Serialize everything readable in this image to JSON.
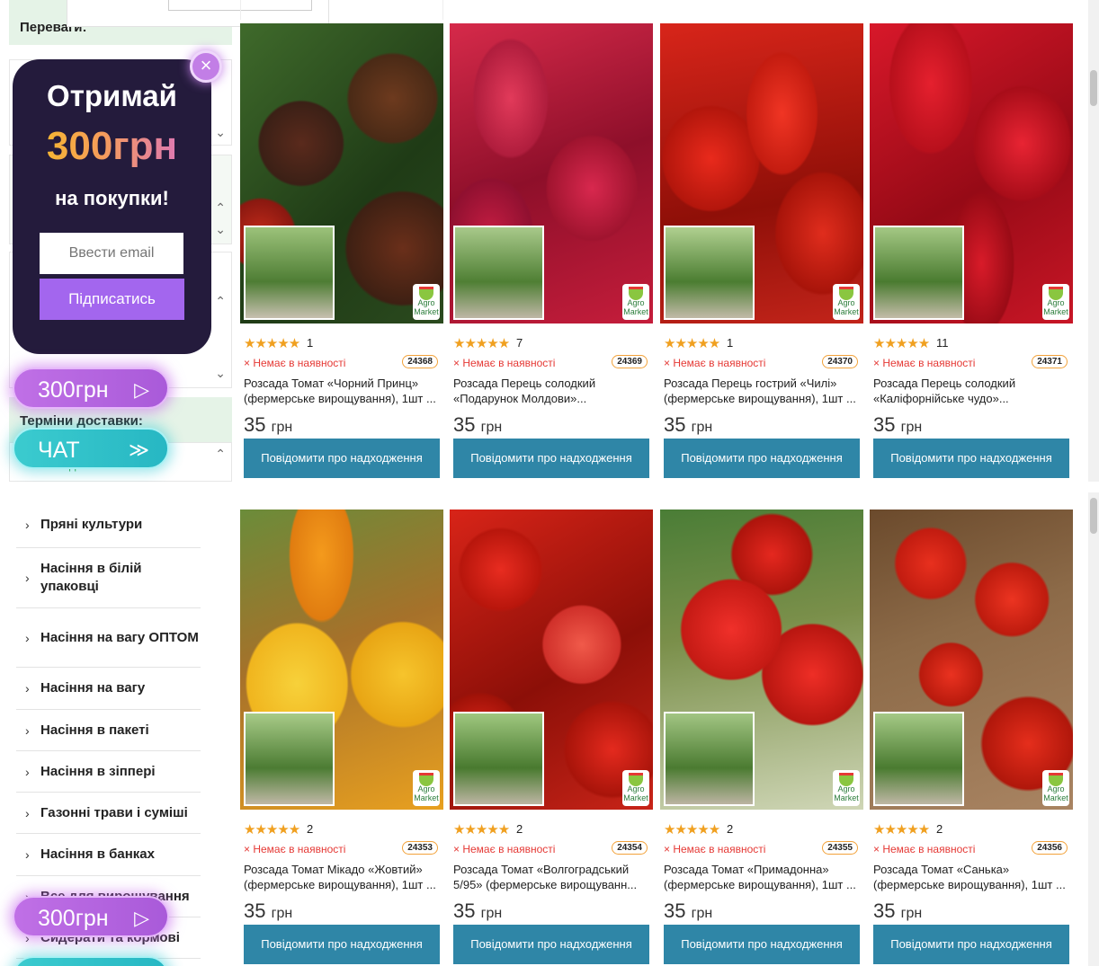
{
  "colors": {
    "accent_green_header": "#e5f3e7",
    "notify_button": "#2f86a7",
    "promo_bg": "#241b3c",
    "promo_button": "#a366ee",
    "promo_amount_gradient": [
      "#f8c51d",
      "#d46ad8"
    ],
    "pill_purple": "#c070e6",
    "pill_teal": "#3bcbcf",
    "out_of_stock": "#e53935",
    "star": "#f0a020",
    "code_border": "#f2a23a"
  },
  "filters": {
    "heading_advantages": "Переваги:",
    "heading_delivery": "Терміни доставки:",
    "delivery_option_partial": "...день"
  },
  "promo": {
    "title": "Отримай",
    "amount": "300грн",
    "subtitle": "на покупки!",
    "email_placeholder": "Ввести email",
    "subscribe_label": "Підписатись",
    "close_icon": "close-icon"
  },
  "pills": {
    "bonus_label": "300грн",
    "bonus_arrow": "▷",
    "chat_label": "ЧАТ",
    "chat_arrow": "≫"
  },
  "categories": [
    {
      "label": "Пряні культури"
    },
    {
      "label": "Насіння в білій упаковці"
    },
    {
      "label": "Насіння на вагу ОПТОМ"
    },
    {
      "label": "Насіння на вагу"
    },
    {
      "label": "Насіння в пакеті"
    },
    {
      "label": "Насіння в зіппері"
    },
    {
      "label": "Газонні трави і суміші"
    },
    {
      "label": "Насіння в банках"
    },
    {
      "label": "Все для вирощування"
    },
    {
      "label": "Сидерати та кормові"
    }
  ],
  "products_top": [
    {
      "stars": "★★★★★",
      "rating_count": "1",
      "stock": "× Немає в наявності",
      "code": "24368",
      "name": "Розсада Томат «Чорний Принц» (фермерське вирощування), 1шт ...",
      "price": "35",
      "currency": "грн",
      "notify": "Повідомити про надходження"
    },
    {
      "stars": "★★★★★",
      "rating_count": "7",
      "stock": "× Немає в наявності",
      "code": "24369",
      "name": "Розсада Перець солодкий «Подарунок Молдови»...",
      "price": "35",
      "currency": "грн",
      "notify": "Повідомити про надходження"
    },
    {
      "stars": "★★★★★",
      "rating_count": "1",
      "stock": "× Немає в наявності",
      "code": "24370",
      "name": "Розсада Перець гострий «Чилі» (фермерське вирощування), 1шт ...",
      "price": "35",
      "currency": "грн",
      "notify": "Повідомити про надходження"
    },
    {
      "stars": "★★★★★",
      "rating_count": "11",
      "stock": "× Немає в наявності",
      "code": "24371",
      "name": "Розсада Перець солодкий «Каліфорнійське чудо»...",
      "price": "35",
      "currency": "грн",
      "notify": "Повідомити про надходження"
    }
  ],
  "products_bottom": [
    {
      "stars": "★★★★★",
      "rating_count": "2",
      "stock": "× Немає в наявності",
      "code": "24353",
      "name": "Розсада Томат Мікадо «Жовтий» (фермерське вирощування), 1шт ...",
      "price": "35",
      "currency": "грн",
      "notify": "Повідомити про надходження"
    },
    {
      "stars": "★★★★★",
      "rating_count": "2",
      "stock": "× Немає в наявності",
      "code": "24354",
      "name": "Розсада Томат «Волгоградський 5/95» (фермерське вирощуванн...",
      "price": "35",
      "currency": "грн",
      "notify": "Повідомити про надходження"
    },
    {
      "stars": "★★★★★",
      "rating_count": "2",
      "stock": "× Немає в наявності",
      "code": "24355",
      "name": "Розсада Томат «Примадонна» (фермерське вирощування), 1шт ...",
      "price": "35",
      "currency": "грн",
      "notify": "Повідомити про надходження"
    },
    {
      "stars": "★★★★★",
      "rating_count": "2",
      "stock": "× Немає в наявності",
      "code": "24356",
      "name": "Розсада Томат «Санька» (фермерське вирощування), 1шт ...",
      "price": "35",
      "currency": "грн",
      "notify": "Повідомити про надходження"
    }
  ],
  "logo_text": "Agro Market"
}
